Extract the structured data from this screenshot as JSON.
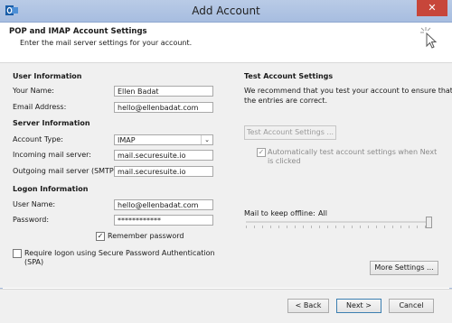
{
  "window": {
    "title": "Add Account",
    "close_glyph": "✕"
  },
  "header": {
    "title": "POP and IMAP Account Settings",
    "subtitle": "Enter the mail server settings for your account."
  },
  "user_info": {
    "heading": "User Information",
    "your_name_label": "Your Name:",
    "your_name_value": "Ellen Badat",
    "email_label": "Email Address:",
    "email_value": "hello@ellenbadat.com"
  },
  "server_info": {
    "heading": "Server Information",
    "account_type_label": "Account Type:",
    "account_type_value": "IMAP",
    "incoming_label": "Incoming mail server:",
    "incoming_value": "mail.securesuite.io",
    "outgoing_label": "Outgoing mail server (SMTP):",
    "outgoing_value": "mail.securesuite.io"
  },
  "logon_info": {
    "heading": "Logon Information",
    "username_label": "User Name:",
    "username_value": "hello@ellenbadat.com",
    "password_label": "Password:",
    "password_value": "************",
    "remember_label": "Remember password",
    "remember_checked": true,
    "spa_label_line1": "Require logon using Secure Password Authentication",
    "spa_label_line2": "(SPA)",
    "spa_checked": false
  },
  "test": {
    "heading": "Test Account Settings",
    "description_line1": "We recommend that you test your account to ensure that",
    "description_line2": "the entries are correct.",
    "button_label": "Test Account Settings ...",
    "auto_test_line1": "Automatically test account settings when Next",
    "auto_test_line2": "is clicked",
    "auto_test_checked": true
  },
  "offline": {
    "label": "Mail to keep offline:",
    "value": "All",
    "slider_level": 1.0
  },
  "more_settings_label": "More Settings ...",
  "footer": {
    "back_label": "< Back",
    "next_label": "Next >",
    "cancel_label": "Cancel"
  },
  "icons": {
    "window_icon": "outlook-icon",
    "header_icon": "cursor-click-icon",
    "check": "✓",
    "dropdown": "⌄"
  },
  "colors": {
    "titlebar": "#a7bde0",
    "close_button": "#c7463a",
    "panel": "#f0f0f0"
  }
}
